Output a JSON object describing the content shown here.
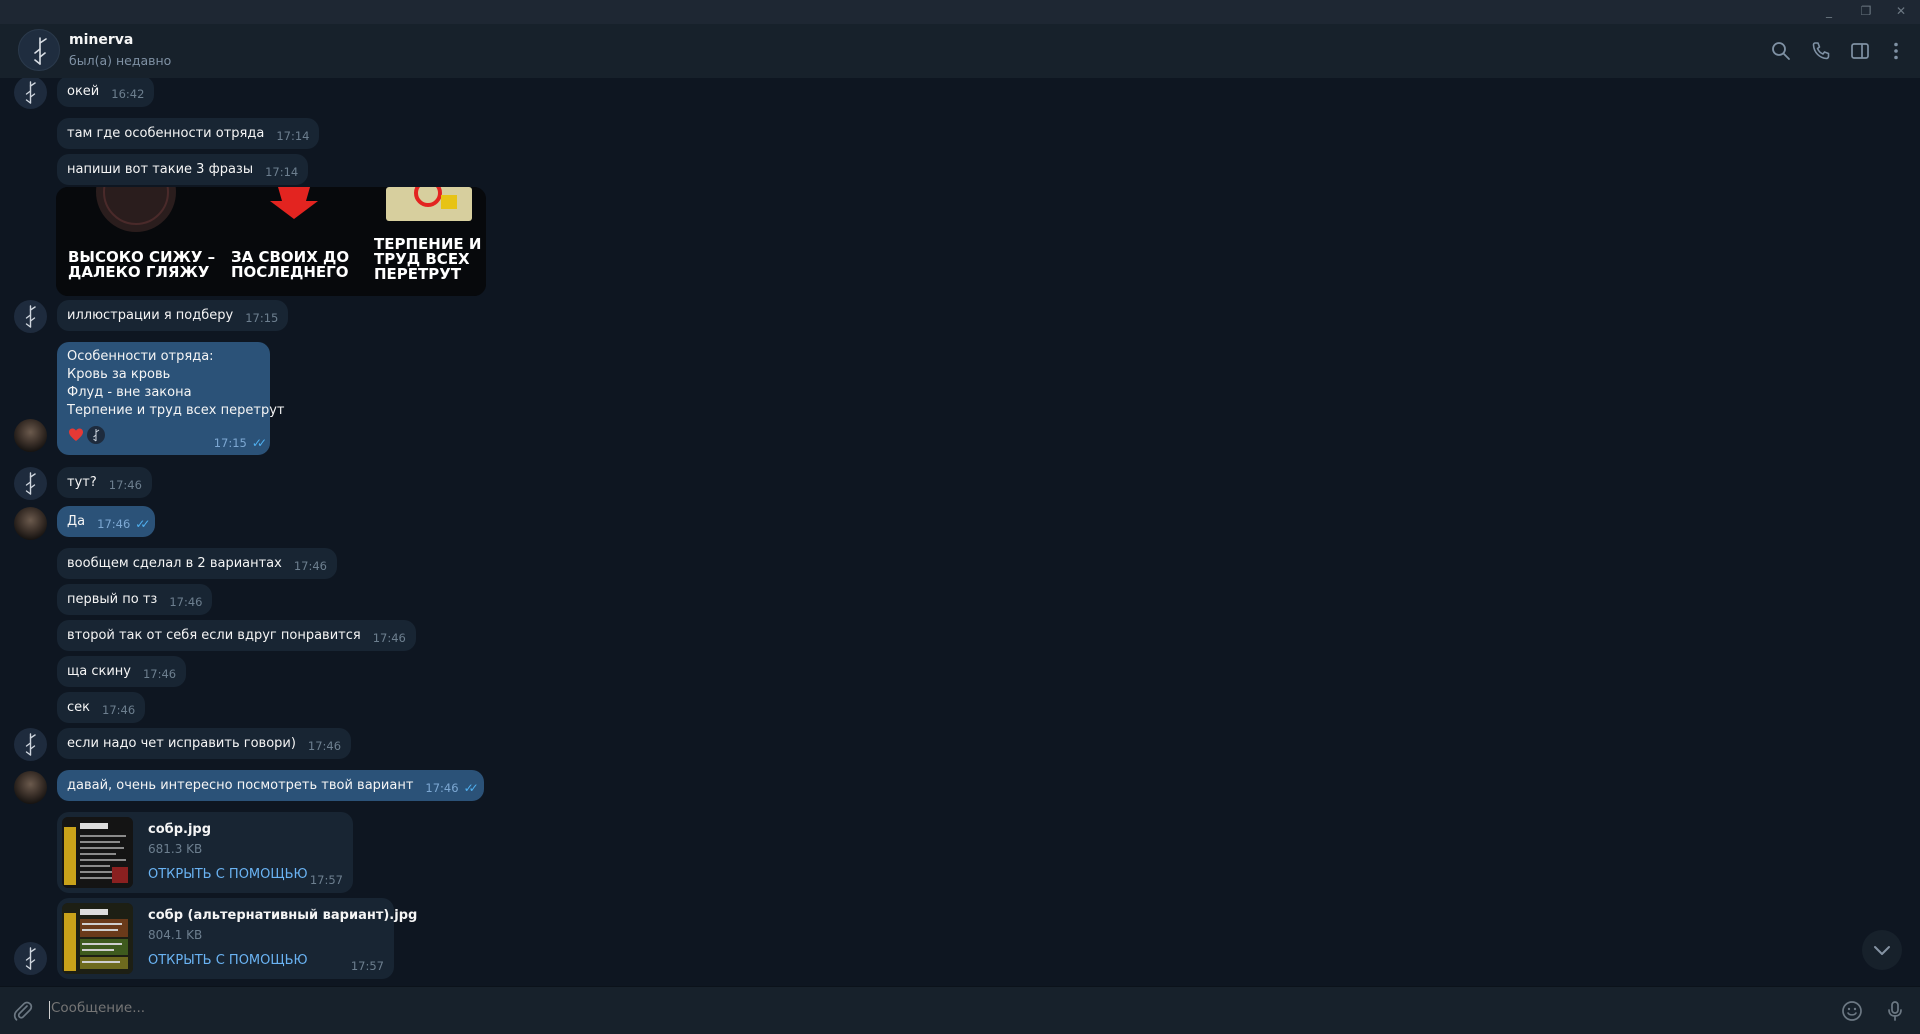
{
  "window": {
    "buttons": [
      {
        "name": "minimize",
        "glyph": "_"
      },
      {
        "name": "restore",
        "glyph": "❐"
      },
      {
        "name": "close",
        "glyph": "✕"
      }
    ]
  },
  "header": {
    "name": "minerva",
    "status": "был(а) недавно",
    "icons": [
      "search-icon",
      "phone-icon",
      "sidebar-toggle-icon",
      "more-vertical-icon"
    ]
  },
  "sticker": {
    "captions": [
      "ВЫСОКО СИЖУ –\nДАЛЕКО ГЛЯЖУ",
      "ЗА СВОИХ ДО\nПОСЛЕДНЕГО",
      "ТЕРПЕНИЕ И\nТРУД ВСЕХ\nПЕРЕТРУТ"
    ]
  },
  "messages": [
    {
      "text": "окей",
      "time": "16:42"
    },
    {
      "text": "там где особенности отряда",
      "time": "17:14"
    },
    {
      "text": "напиши вот такие 3 фразы",
      "time": "17:14"
    },
    {
      "text": "иллюстрации я подберу",
      "time": "17:15"
    },
    {
      "lines": [
        "Особенности отряда:",
        "Кровь за кровь",
        "Флуд - вне закона",
        "Терпение и труд всех перетрут"
      ],
      "time": "17:15"
    },
    {
      "text": "тут?",
      "time": "17:46"
    },
    {
      "text": "Да",
      "time": "17:46"
    },
    {
      "text": "вообщем сделал в 2 вариантах",
      "time": "17:46"
    },
    {
      "text": "первый по тз",
      "time": "17:46"
    },
    {
      "text": "второй так от себя если вдруг понравится",
      "time": "17:46"
    },
    {
      "text": "ща скину",
      "time": "17:46"
    },
    {
      "text": "сек",
      "time": "17:46"
    },
    {
      "text": "если надо чет исправить говори)",
      "time": "17:46"
    },
    {
      "text": "давай, очень интересно посмотреть твой вариант",
      "time": "17:46"
    }
  ],
  "files": [
    {
      "name": "собр.jpg",
      "size": "681.3 KB",
      "action": "ОТКРЫТЬ С ПОМОЩЬЮ",
      "time": "17:57"
    },
    {
      "name": "собр (альтернативный вариант).jpg",
      "size": "804.1 KB",
      "action": "ОТКРЫТЬ С ПОМОЩЬЮ",
      "time": "17:57"
    }
  ],
  "composer": {
    "placeholder": "Сообщение..."
  },
  "colors": {
    "background": "#0e1621",
    "incoming_bubble": "#182533",
    "outgoing_bubble": "#2b5278",
    "link": "#6ab3f3",
    "read_check": "#4fb0f0",
    "reaction_heart": "#e53935"
  }
}
